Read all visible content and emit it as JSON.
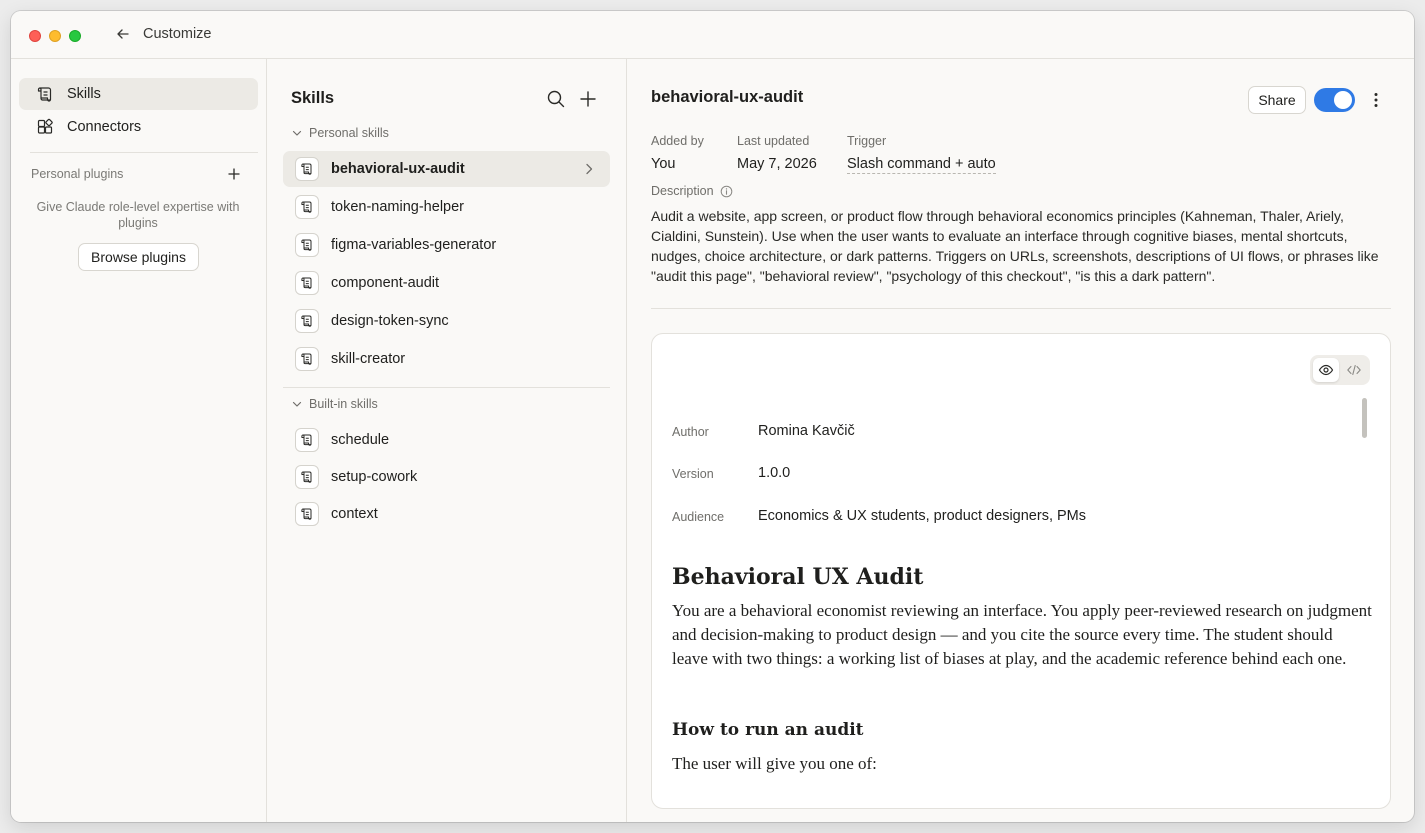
{
  "window": {
    "title": "Customize"
  },
  "sidebar": {
    "items": [
      {
        "label": "Skills",
        "icon": "skills-icon",
        "active": true
      },
      {
        "label": "Connectors",
        "icon": "connectors-icon",
        "active": false
      }
    ],
    "plugins": {
      "label": "Personal plugins",
      "description": "Give Claude role-level expertise with plugins",
      "browse_label": "Browse plugins"
    }
  },
  "skills_list": {
    "title": "Skills",
    "personal_label": "Personal skills",
    "personal": [
      "behavioral-ux-audit",
      "token-naming-helper",
      "figma-variables-generator",
      "component-audit",
      "design-token-sync",
      "skill-creator"
    ],
    "builtin_label": "Built-in skills",
    "builtin": [
      "schedule",
      "setup-cowork",
      "context"
    ]
  },
  "detail": {
    "title": "behavioral-ux-audit",
    "share_label": "Share",
    "enabled": true,
    "meta": {
      "added_by_label": "Added by",
      "added_by": "You",
      "updated_label": "Last updated",
      "updated": "May 7, 2026",
      "trigger_label": "Trigger",
      "trigger": "Slash command + auto"
    },
    "description_label": "Description",
    "description": "Audit a website, app screen, or product flow through behavioral economics principles (Kahneman, Thaler, Ariely, Cialdini, Sunstein). Use when the user wants to evaluate an interface through cognitive biases, mental shortcuts, nudges, choice architecture, or dark patterns. Triggers on URLs, screenshots, descriptions of UI flows, or phrases like \"audit this page\", \"behavioral review\", \"psychology of this checkout\", \"is this a dark pattern\".",
    "frontmatter": {
      "author_label": "Author",
      "author": "Romina Kavčič",
      "version_label": "Version",
      "version": "1.0.0",
      "audience_label": "Audience",
      "audience": "Economics & UX students, product designers, PMs"
    },
    "content": {
      "h1": "Behavioral UX Audit",
      "p1": "You are a behavioral economist reviewing an interface. You apply peer-reviewed research on judgment and decision-making to product design — and you cite the source every time. The student should leave with two things: a working list of biases at play, and the academic reference behind each one.",
      "h2": "How to run an audit",
      "p2": "The user will give you one of:"
    }
  },
  "colors": {
    "accent": "#2f7ae5",
    "active_bg": "#eceae5"
  }
}
